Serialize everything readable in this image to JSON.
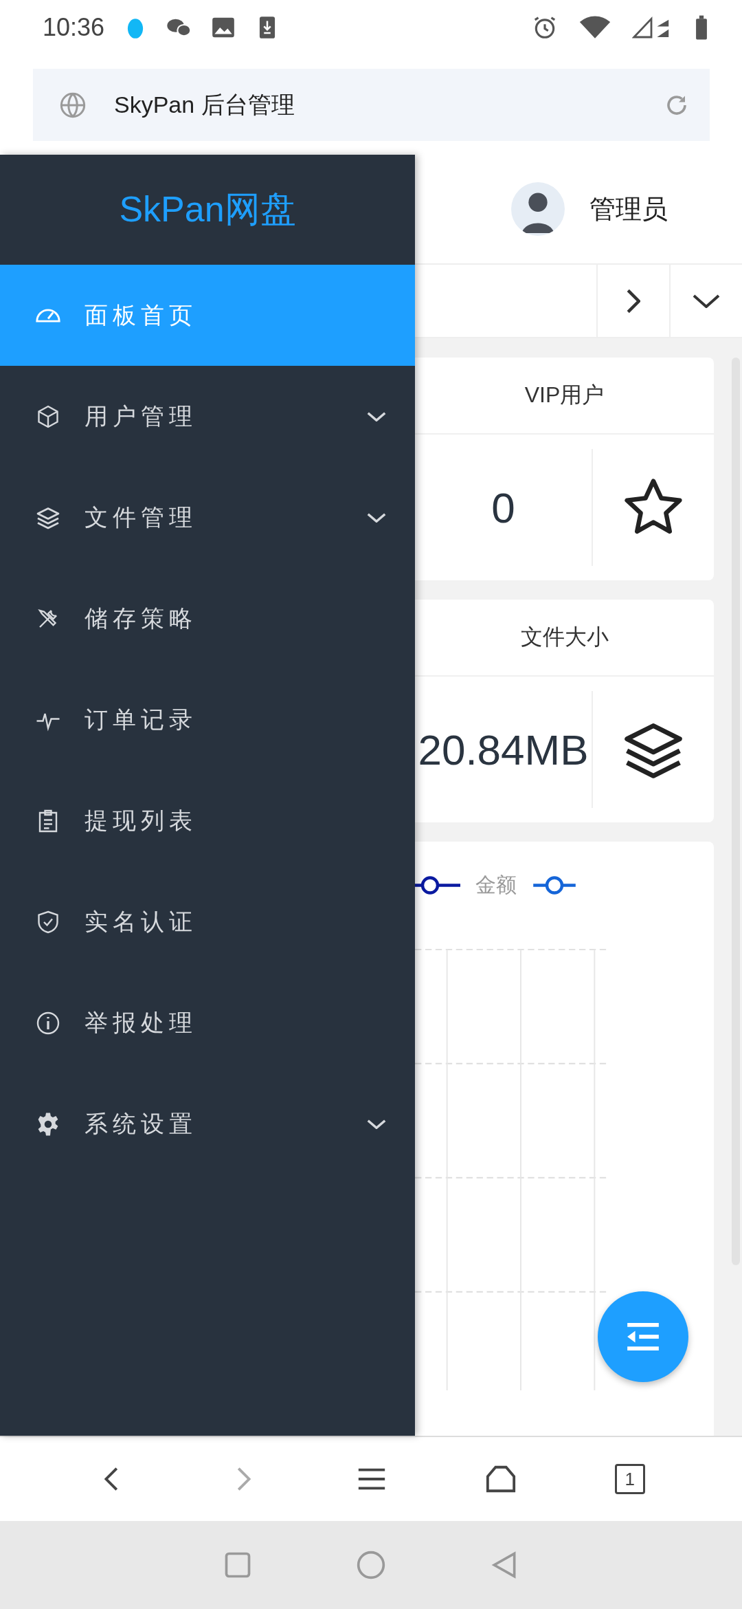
{
  "status_bar": {
    "time": "10:36"
  },
  "browser": {
    "title": "SkyPan 后台管理",
    "tab_count": "1"
  },
  "sidebar": {
    "brand": "SkPan网盘",
    "items": [
      {
        "label": "面板首页",
        "selected": true,
        "expandable": false
      },
      {
        "label": "用户管理",
        "selected": false,
        "expandable": true
      },
      {
        "label": "文件管理",
        "selected": false,
        "expandable": true
      },
      {
        "label": "储存策略",
        "selected": false,
        "expandable": false
      },
      {
        "label": "订单记录",
        "selected": false,
        "expandable": false
      },
      {
        "label": "提现列表",
        "selected": false,
        "expandable": false
      },
      {
        "label": "实名认证",
        "selected": false,
        "expandable": false
      },
      {
        "label": "举报处理",
        "selected": false,
        "expandable": false
      },
      {
        "label": "系统设置",
        "selected": false,
        "expandable": true
      }
    ]
  },
  "header": {
    "user": "管理员"
  },
  "cards": [
    {
      "title": "VIP用户",
      "value": "0"
    },
    {
      "title": "文件大小",
      "value": "20.84MB"
    }
  ],
  "chart_card": {
    "legend": [
      {
        "label": "金额",
        "color": "#1565d8"
      }
    ]
  }
}
